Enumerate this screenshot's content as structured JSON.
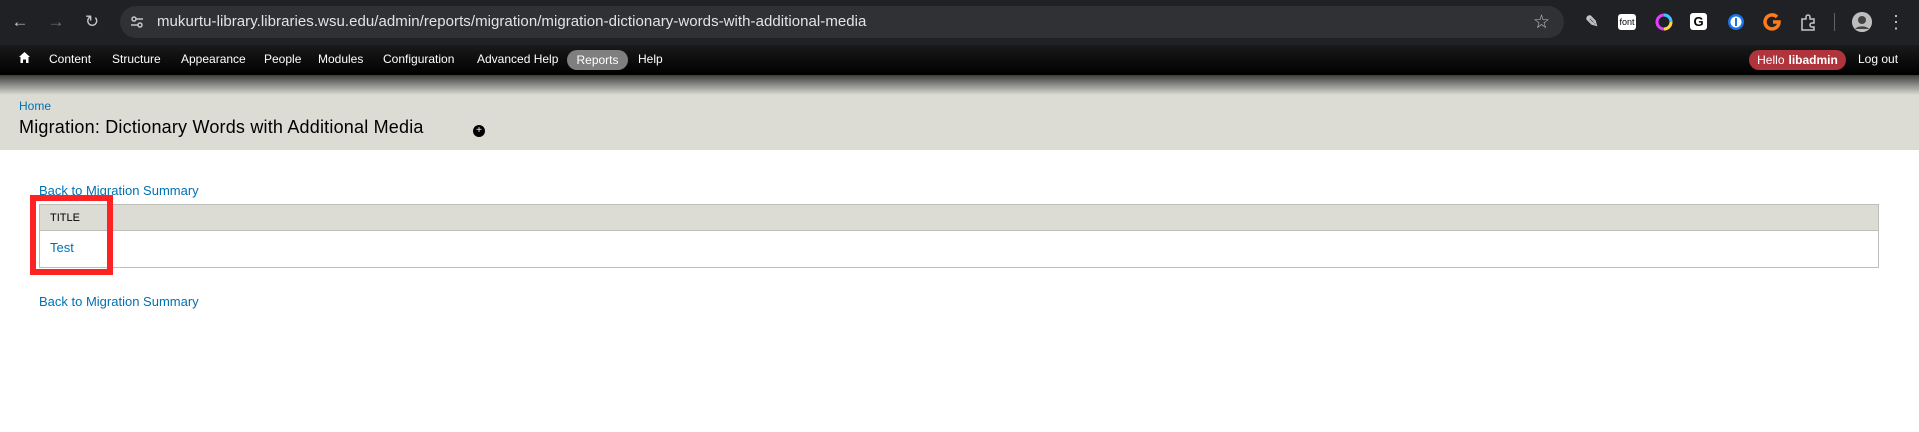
{
  "browser": {
    "url": "mukurtu-library.libraries.wsu.edu/admin/reports/migration/migration-dictionary-words-with-additional-media",
    "back_icon": "arrow-left",
    "forward_icon": "arrow-right",
    "reload_icon": "reload",
    "extensions": [
      "eyedropper-icon",
      "font-extension-icon",
      "color-wheel-icon",
      "grammarly-icon",
      "1password-icon",
      "orange-extension-icon",
      "puzzle-icon",
      "profile-avatar"
    ],
    "font_ext_label": "font",
    "grammar_ext_label": "G"
  },
  "toolbar": {
    "items": [
      "Content",
      "Structure",
      "Appearance",
      "People",
      "Modules",
      "Configuration",
      "Advanced Help",
      "Reports",
      "Help"
    ],
    "hello_label": "Hello",
    "username": "libadmin",
    "logout": "Log out",
    "active_item": "Reports"
  },
  "header": {
    "breadcrumb": "Home",
    "title": "Migration: Dictionary Words with Additional Media",
    "shortcut_symbol": "+"
  },
  "main": {
    "back_link": "Back to Migration Summary",
    "table": {
      "columns": [
        "TITLE"
      ],
      "rows": [
        [
          "Test"
        ]
      ]
    }
  },
  "colors": {
    "link": "#0071b3",
    "header_bg": "#dcdcd5",
    "highlight": "#ff2222",
    "hello_pill": "#b0343c"
  }
}
